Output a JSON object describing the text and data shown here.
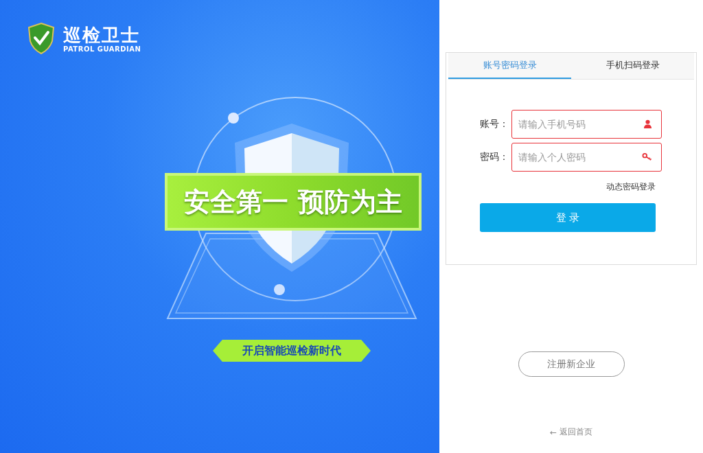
{
  "brand": {
    "name": "巡检卫士",
    "subtitle": "PATROL GUARDIAN"
  },
  "hero": {
    "slogan": [
      "安全第一",
      "预防为主"
    ],
    "tagline": "开启智能巡检新时代"
  },
  "login": {
    "tabs": [
      {
        "label": "账号密码登录",
        "selected": true
      },
      {
        "label": "手机扫码登录",
        "selected": false
      }
    ],
    "fields": [
      {
        "label": "账号：",
        "placeholder": "请输入手机号码",
        "kind": "user"
      },
      {
        "label": "密码：",
        "placeholder": "请输入个人密码",
        "kind": "key"
      }
    ],
    "dynamic_link": "动态密码登录",
    "submit": "登 录"
  },
  "register": "注册新企业",
  "back": {
    "arrow": "←",
    "label": "返回首页"
  }
}
